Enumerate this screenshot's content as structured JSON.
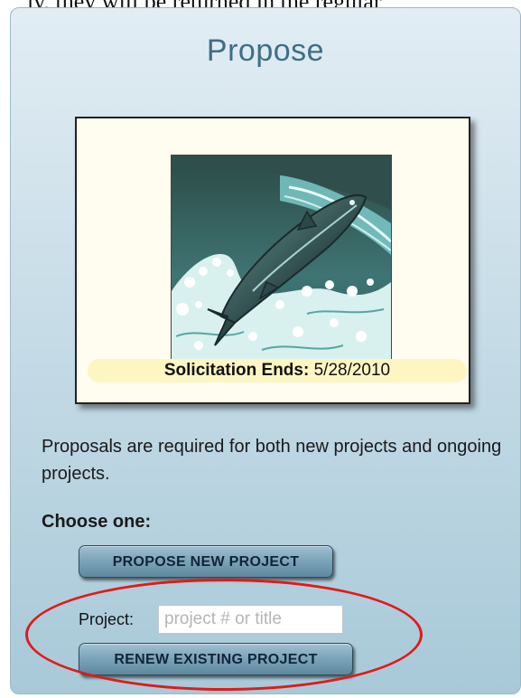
{
  "cut_text": "ly, they will be returned in the regular",
  "panel": {
    "title": "Propose",
    "solicitation_label": "Solicitation Ends:",
    "solicitation_date": "5/28/2010",
    "image_icon": "leaping-salmon-illustration",
    "description": "Proposals are required for both new projects and ongoing projects.",
    "choose_label": "Choose one:",
    "propose_button": "PROPOSE NEW PROJECT",
    "project_label": "Project:",
    "project_placeholder": "project # or title",
    "project_value": "",
    "renew_button": "RENEW EXISTING PROJECT"
  },
  "colors": {
    "title": "#3f6e86",
    "annotation_circle": "#e01a1a",
    "solicitation_bg": "#fdf6c3"
  }
}
